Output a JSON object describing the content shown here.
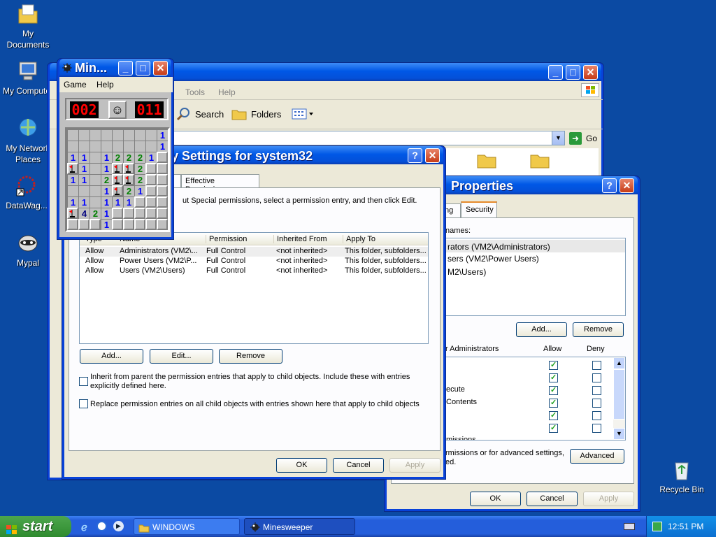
{
  "desktop": {
    "icons": [
      {
        "label": "My Documents"
      },
      {
        "label": "My Computer"
      },
      {
        "label": "My Network Places"
      },
      {
        "label": "DataWag..."
      },
      {
        "label": "Mypal"
      },
      {
        "label": "Recycle Bin"
      }
    ]
  },
  "explorer": {
    "menu": [
      "Tools",
      "Help"
    ],
    "toolbar": {
      "search": "Search",
      "folders": "Folders"
    },
    "go": "Go"
  },
  "minesweeper": {
    "title": "Min...",
    "menu": [
      "Game",
      "Help"
    ],
    "mine_counter": "002",
    "timer": "011",
    "smiley": "☺"
  },
  "advanced_security": {
    "title": "...y Settings for system32",
    "tabs": [
      "r",
      "Effective Permissions"
    ],
    "description": "ut Special permissions, select a permission entry, and then click Edit.",
    "columns": [
      "Type",
      "Name",
      "Permission",
      "Inherited From",
      "Apply To"
    ],
    "rows": [
      [
        "Allow",
        "Administrators (VM2\\...",
        "Full Control",
        "<not inherited>",
        "This folder, subfolders..."
      ],
      [
        "Allow",
        "Power Users (VM2\\P...",
        "Full Control",
        "<not inherited>",
        "This folder, subfolders..."
      ],
      [
        "Allow",
        "Users (VM2\\Users)",
        "Full Control",
        "<not inherited>",
        "This folder, subfolders..."
      ]
    ],
    "buttons": {
      "add": "Add...",
      "edit": "Edit...",
      "remove": "Remove"
    },
    "inherit_label": "Inherit from parent the permission entries that apply to child objects. Include these with entries explicitly defined here.",
    "replace_label": "Replace permission entries on all child objects with entries shown here that apply to child objects",
    "ok": "OK",
    "cancel": "Cancel",
    "apply": "Apply"
  },
  "properties": {
    "title": "Properties",
    "tabs": [
      "ng",
      "Security"
    ],
    "names_label": "names:",
    "users": [
      "rators (VM2\\Administrators)",
      "sers (VM2\\Power Users)",
      "M2\\Users)"
    ],
    "add": "Add...",
    "remove": "Remove",
    "perms_for": "r Administrators",
    "allow": "Allow",
    "deny": "Deny",
    "perm_rows": [
      "",
      "",
      "ecute",
      "Contents",
      "",
      "",
      "missions"
    ],
    "allow_checked": [
      true,
      true,
      true,
      true,
      true,
      true,
      false
    ],
    "advanced_note": "rmissions or for advanced settings,",
    "advanced_note2": "ed.",
    "advanced": "Advanced",
    "ok": "OK",
    "cancel": "Cancel",
    "apply": "Apply"
  },
  "taskbar": {
    "start": "start",
    "tasks": [
      "WINDOWS",
      "Minesweeper"
    ],
    "clock": "12:51 PM"
  }
}
